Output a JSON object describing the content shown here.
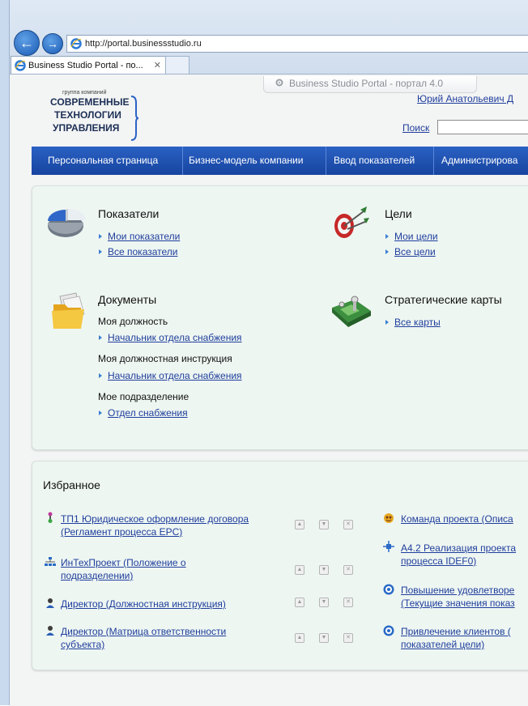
{
  "browser": {
    "address": "http://portal.businessstudio.ru",
    "tab_title": "Business Studio Portal - по...",
    "tab_close": "✕"
  },
  "logo": {
    "small": "группа компаний",
    "line1": "СОВРЕМЕННЫЕ",
    "line2": "ТЕХНОЛОГИИ",
    "line3": "УПРАВЛЕНИЯ"
  },
  "portal_tab": "Business Studio Portal - портал 4.0",
  "user_name": "Юрий Анатольевич Д",
  "search": {
    "label": "Поиск",
    "value": ""
  },
  "nav": {
    "items": [
      "Персональная страница",
      "Бизнес-модель компании",
      "Ввод показателей",
      "Администрирова"
    ]
  },
  "sections": {
    "indicators": {
      "title": "Показатели",
      "links": [
        "Мои показатели",
        "Все показатели"
      ]
    },
    "goals": {
      "title": "Цели",
      "links": [
        "Мои цели",
        "Все цели"
      ]
    },
    "documents": {
      "title": "Документы",
      "position_label": "Моя должность",
      "position_link": "Начальник отдела снабжения",
      "instruction_label": "Моя должностная инструкция",
      "instruction_link": "Начальник отдела снабжения",
      "division_label": "Мое подразделение",
      "division_link": "Отдел снабжения"
    },
    "strategy": {
      "title": "Стратегические карты",
      "links": [
        "Все карты"
      ]
    }
  },
  "favorites": {
    "title": "Избранное",
    "left": [
      {
        "line1": "ТП1 Юридическое оформление договора",
        "line2": "(Регламент процесса EPC)"
      },
      {
        "line1": "ИнТехПроект (Положение о",
        "line2": "подразделении)"
      },
      {
        "line1": "Директор (Должностная инструкция)",
        "line2": ""
      },
      {
        "line1": "Директор (Матрица ответственности",
        "line2": "субъекта)"
      }
    ],
    "right": [
      {
        "line1": "Команда проекта (Описа",
        "line2": ""
      },
      {
        "line1": "А4.2 Реализация проекта",
        "line2": "процесса IDEF0)"
      },
      {
        "line1": "Повышение удовлетворе",
        "line2": "(Текущие значения показ"
      },
      {
        "line1": "Привлечение клиентов (",
        "line2": "показателей цели)"
      }
    ],
    "action_icons": [
      "up-arrow-icon",
      "down-arrow-icon",
      "delete-icon"
    ]
  },
  "colors": {
    "nav_bg": "#1f53b5",
    "link": "#1f3e9c",
    "panel_bg": "#eef6f2",
    "page_bg": "#f3f4f4"
  }
}
